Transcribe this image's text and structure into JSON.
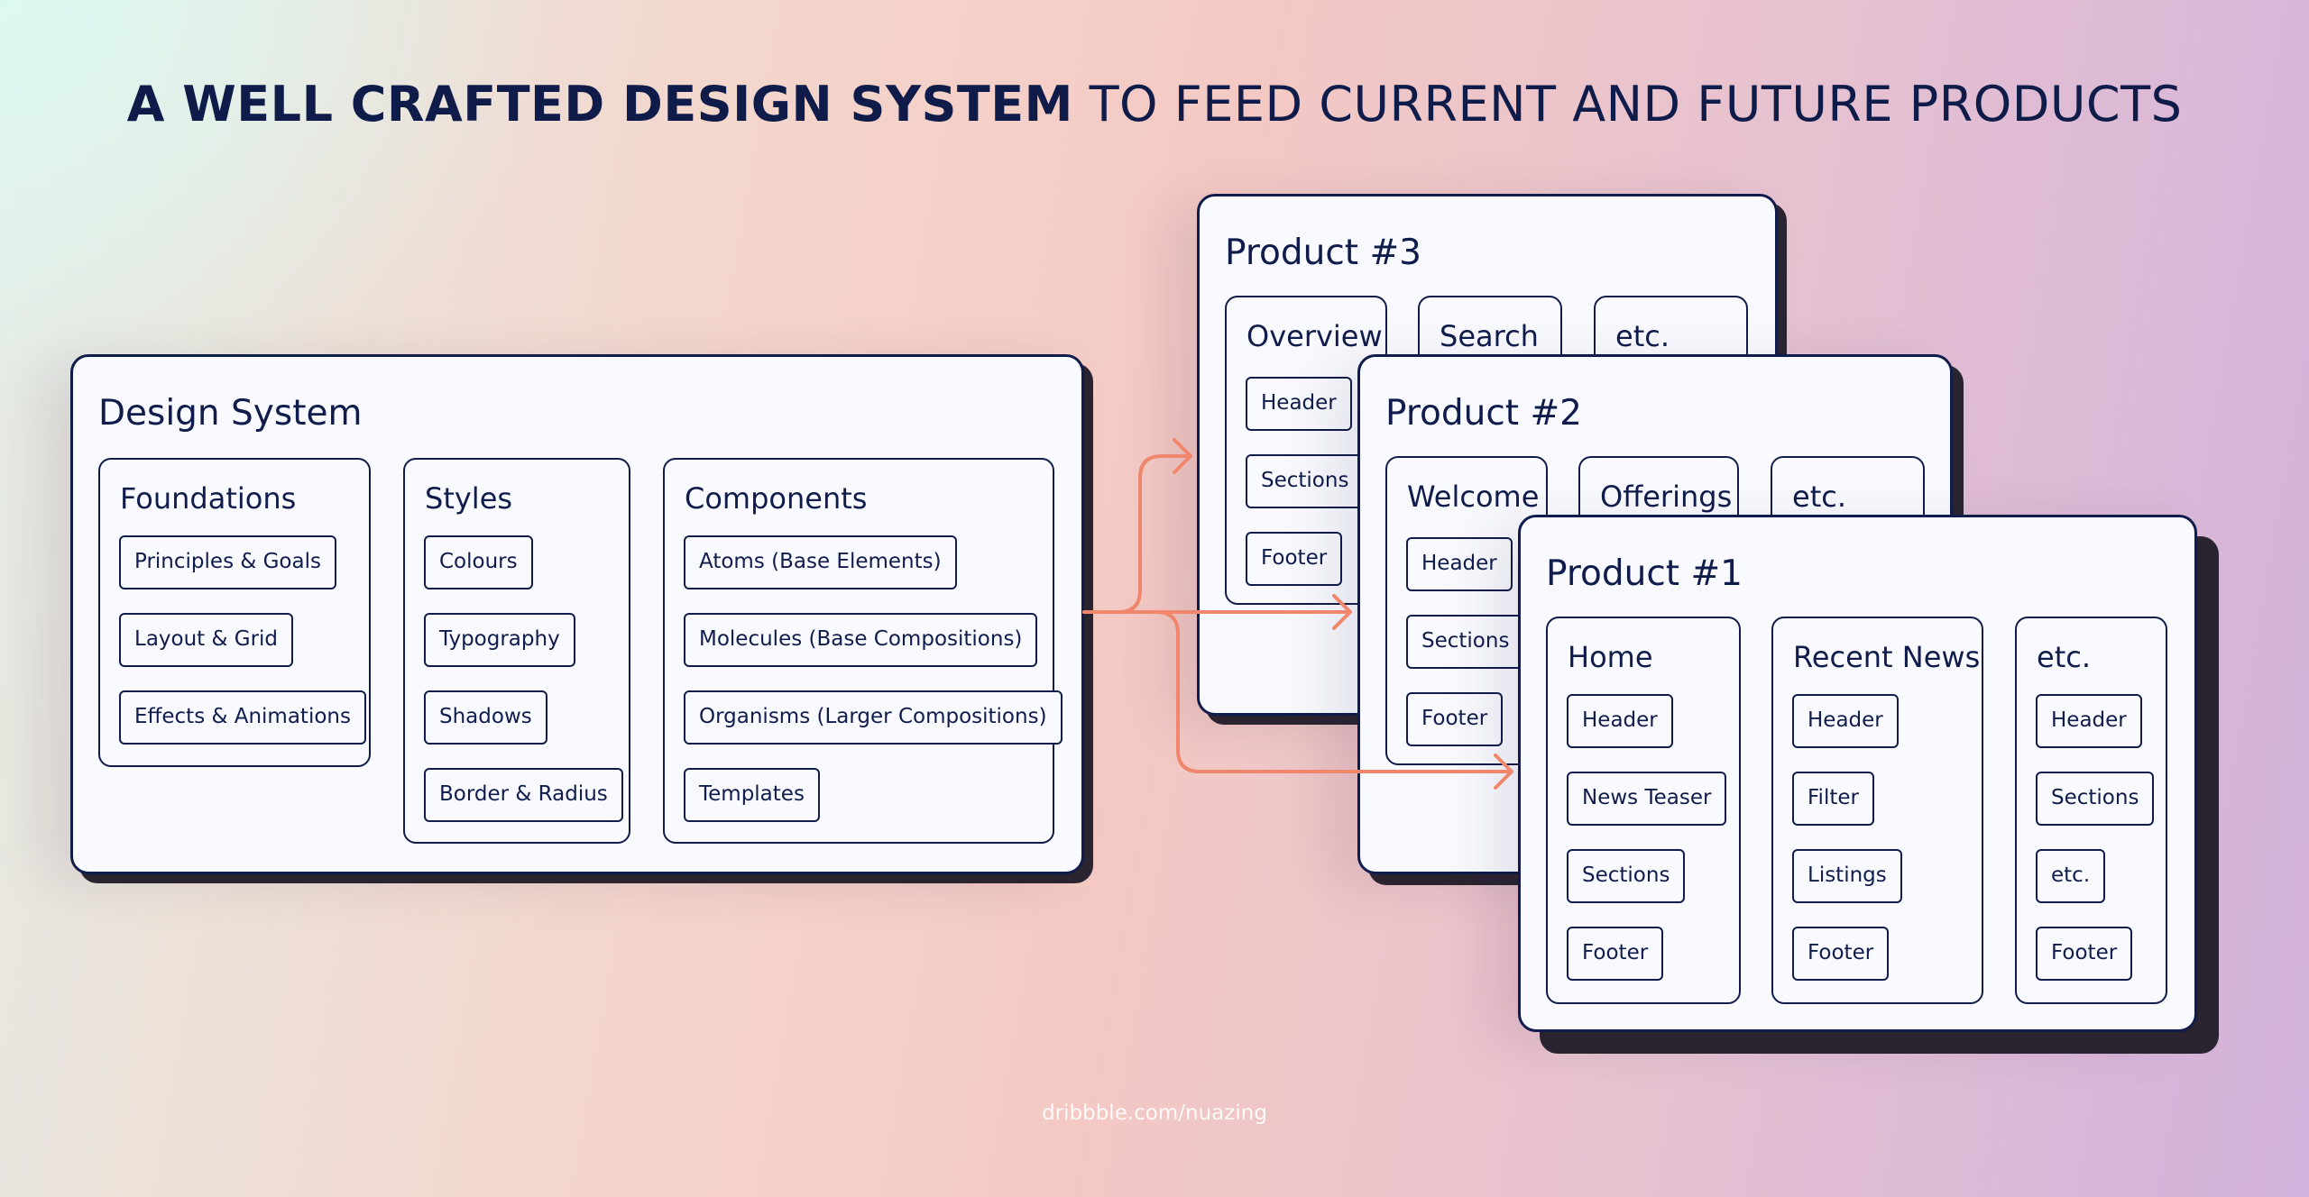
{
  "title": {
    "bold": "A WELL CRAFTED DESIGN SYSTEM",
    "light": " TO FEED CURRENT AND FUTURE PRODUCTS"
  },
  "colors": {
    "ink": "#101c4b",
    "arrow": "#f0866c",
    "card": "#f9faff",
    "shadow": "#2a2430"
  },
  "cards": [
    {
      "title": "Product #3",
      "sections": [
        {
          "title": "Overview",
          "items": [
            "Header",
            "Sections",
            "Footer"
          ]
        },
        {
          "title": "Search",
          "items": []
        },
        {
          "title": "etc.",
          "items": []
        }
      ]
    },
    {
      "title": "Product #2",
      "sections": [
        {
          "title": "Welcome",
          "items": [
            "Header",
            "Sections",
            "Footer"
          ]
        },
        {
          "title": "Offerings",
          "items": []
        },
        {
          "title": "etc.",
          "items": []
        }
      ]
    },
    {
      "title": "Design System",
      "sections": [
        {
          "title": "Foundations",
          "items": [
            "Principles & Goals",
            "Layout & Grid",
            "Effects & Animations"
          ]
        },
        {
          "title": "Styles",
          "items": [
            "Colours",
            "Typography",
            "Shadows",
            "Border & Radius"
          ]
        },
        {
          "title": "Components",
          "items": [
            "Atoms  (Base Elements)",
            "Molecules (Base Compositions)",
            "Organisms (Larger Compositions)",
            "Templates"
          ]
        }
      ]
    },
    {
      "title": "Product #1",
      "sections": [
        {
          "title": "Home",
          "items": [
            "Header",
            "News Teaser",
            "Sections",
            "Footer"
          ]
        },
        {
          "title": "Recent News",
          "items": [
            "Header",
            "Filter",
            "Listings",
            "Footer"
          ]
        },
        {
          "title": "etc.",
          "items": [
            "Header",
            "Sections",
            "etc.",
            "Footer"
          ]
        }
      ]
    }
  ],
  "credit": "dribbble.com/nuazing"
}
